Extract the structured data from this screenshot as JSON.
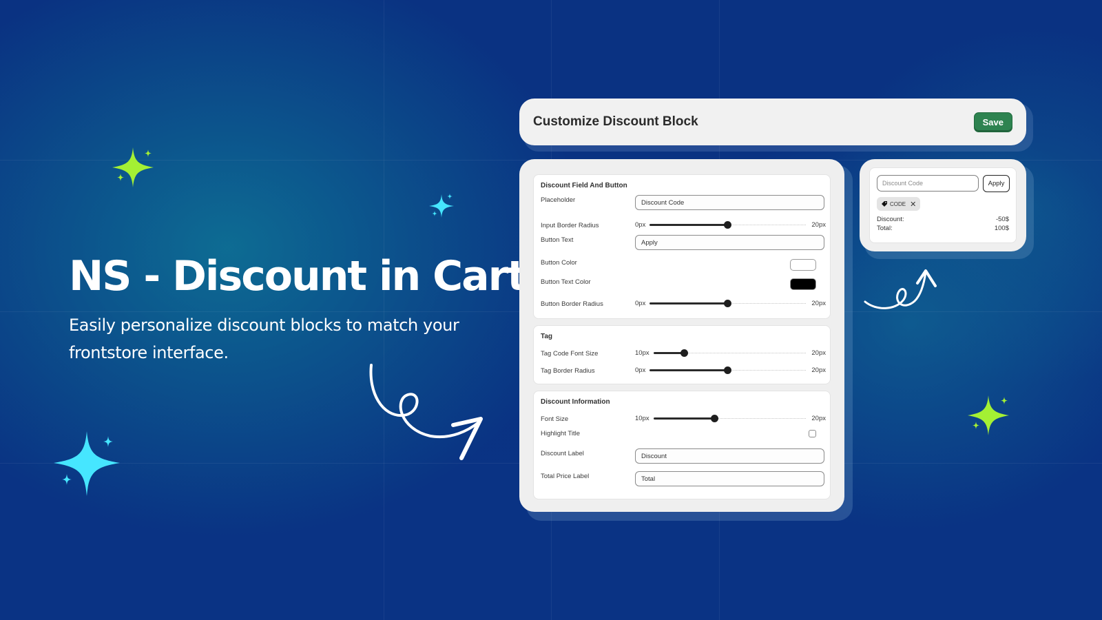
{
  "hero": {
    "title": "NS - Discount in Cart",
    "subtitle": "Easily personalize discount blocks to match your frontstore interface."
  },
  "colors": {
    "background": "#0a3384",
    "sparkle_green": "#a4f034",
    "sparkle_cyan": "#46e6ff",
    "save_green": "#2e8350",
    "card_bg": "#efefef"
  },
  "header": {
    "title": "Customize Discount Block",
    "save_label": "Save"
  },
  "settings": {
    "discount_field": {
      "title": "Discount Field And Button",
      "placeholder_label": "Placeholder",
      "placeholder_value": "Discount Code",
      "input_border_radius": {
        "label": "Input Border Radius",
        "min": "0px",
        "max": "20px",
        "value": 10
      },
      "button_text_label": "Button Text",
      "button_text_value": "Apply",
      "button_color": {
        "label": "Button Color",
        "value": "#ffffff"
      },
      "button_text_color": {
        "label": "Button Text Color",
        "value": "#000000"
      },
      "button_border_radius": {
        "label": "Button Border Radius",
        "min": "0px",
        "max": "20px",
        "value": 10
      }
    },
    "tag": {
      "title": "Tag",
      "tag_code_font_size": {
        "label": "Tag Code Font Size",
        "min": "10px",
        "max": "20px",
        "value": 12
      },
      "tag_border_radius": {
        "label": "Tag Border Radius",
        "min": "0px",
        "max": "20px",
        "value": 10
      }
    },
    "discount_info": {
      "title": "Discount Information",
      "font_size": {
        "label": "Font Size",
        "min": "10px",
        "max": "20px",
        "value": 14
      },
      "highlight_title": {
        "label": "Highlight Title",
        "checked": false
      },
      "discount_label_label": "Discount Label",
      "discount_label_value": "Discount",
      "total_price_label_label": "Total Price Label",
      "total_price_label_value": "Total"
    }
  },
  "preview": {
    "input_placeholder": "Discount Code",
    "apply_label": "Apply",
    "tag_code": "CODE",
    "discount_label": "Discount:",
    "discount_value": "-50$",
    "total_label": "Total:",
    "total_value": "100$"
  }
}
